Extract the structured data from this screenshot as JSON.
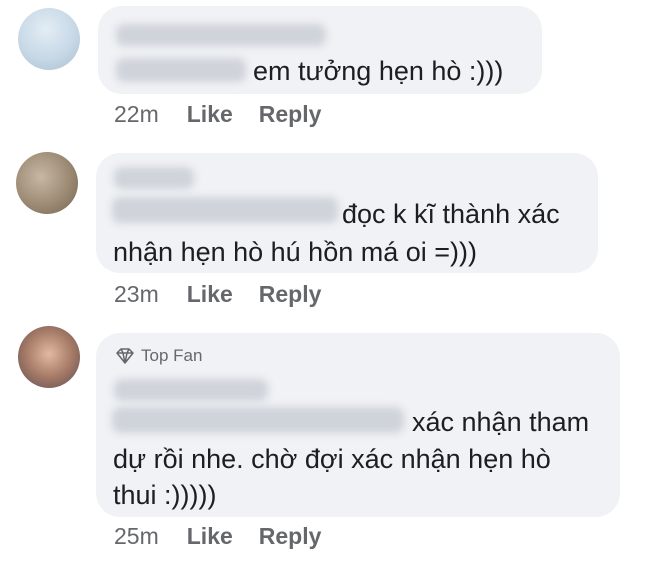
{
  "comments": [
    {
      "text_lines": [
        "em tưởng hẹn hò :)))"
      ],
      "time": "22m",
      "like_label": "Like",
      "reply_label": "Reply"
    },
    {
      "text_lines": [
        "đọc k kĩ thành xác",
        "nhận hẹn hò hú hồn má oi =)))"
      ],
      "time": "23m",
      "like_label": "Like",
      "reply_label": "Reply"
    },
    {
      "badge": "Top Fan",
      "text_lines": [
        "xác nhận tham",
        "dự rồi nhe. chờ đợi xác nhận hẹn hò",
        "thui :)))))"
      ],
      "time": "25m",
      "like_label": "Like",
      "reply_label": "Reply"
    }
  ],
  "colors": {
    "bubble": "#f0f2f5",
    "text": "#1c1e21",
    "meta": "#65676b"
  }
}
